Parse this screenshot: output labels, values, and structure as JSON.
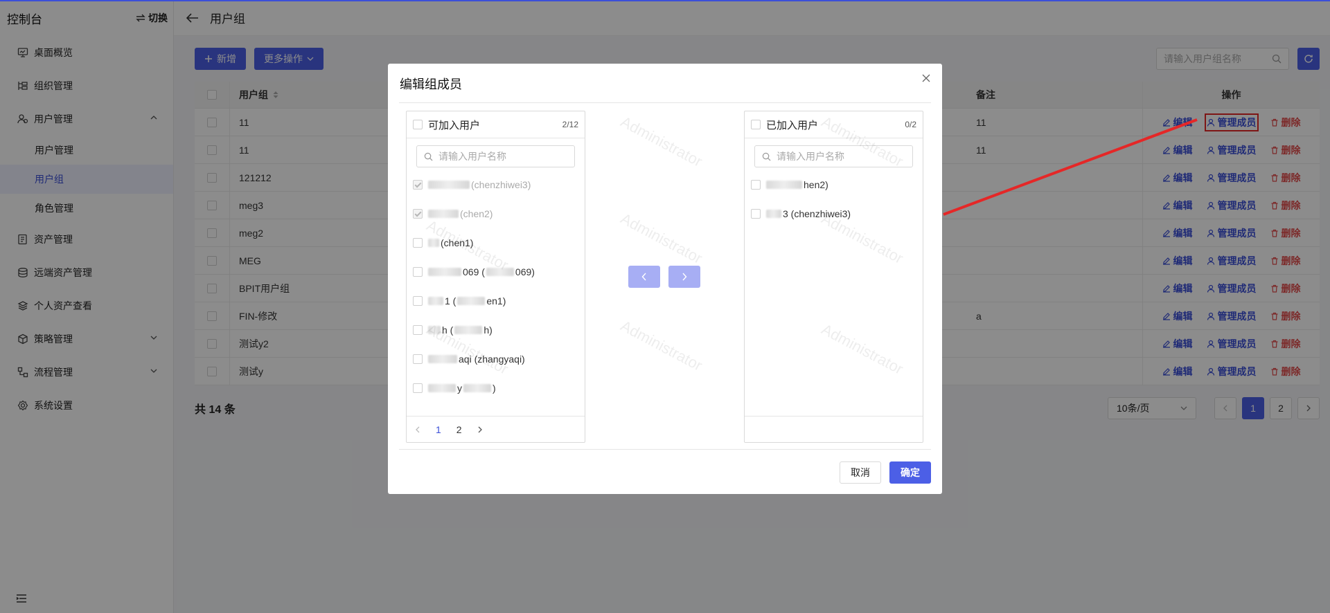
{
  "sidebar": {
    "title": "控制台",
    "switch_label": "切换",
    "items": [
      {
        "label": "桌面概览",
        "icon": "monitor-icon"
      },
      {
        "label": "组织管理",
        "icon": "org-tree-icon"
      },
      {
        "label": "用户管理",
        "icon": "users-icon"
      },
      {
        "label": "资产管理",
        "icon": "asset-icon"
      },
      {
        "label": "远端资产管理",
        "icon": "remote-asset-icon"
      },
      {
        "label": "个人资产查看",
        "icon": "layers-icon"
      },
      {
        "label": "策略管理",
        "icon": "cube-icon"
      },
      {
        "label": "流程管理",
        "icon": "flow-icon"
      },
      {
        "label": "系统设置",
        "icon": "gear-icon"
      }
    ],
    "sub_items": [
      "用户管理",
      "用户组",
      "角色管理"
    ]
  },
  "header": {
    "title": "用户组"
  },
  "toolbar": {
    "add_label": "新增",
    "more_label": "更多操作",
    "search_placeholder": "请输入用户组名称"
  },
  "table": {
    "columns": {
      "name": "用户组",
      "note": "备注",
      "ops": "操作"
    },
    "ops": {
      "edit": "编辑",
      "member": "管理成员",
      "delete": "删除"
    },
    "rows": [
      {
        "name": "11",
        "note": "11"
      },
      {
        "name": "11",
        "note": "11"
      },
      {
        "name": "121212",
        "note": ""
      },
      {
        "name": "meg3",
        "note": ""
      },
      {
        "name": "meg2",
        "note": ""
      },
      {
        "name": "MEG",
        "note": ""
      },
      {
        "name": "BPIT用户组",
        "note": ""
      },
      {
        "name": "FIN-修改",
        "note": "a"
      },
      {
        "name": "测试y2",
        "note": ""
      },
      {
        "name": "测试y",
        "note": ""
      }
    ],
    "total": "共 14 条",
    "page_size": "10条/页",
    "pages": [
      "1",
      "2"
    ]
  },
  "modal": {
    "title": "编辑组成员",
    "left": {
      "title": "可加入用户",
      "count": "2/12",
      "placeholder": "请输入用户名称",
      "items": [
        {
          "visible": "(chenzhiwei3)",
          "checked": true,
          "disabled": true
        },
        {
          "visible": "(chen2)",
          "checked": true,
          "disabled": true
        },
        {
          "visible": "(chen1)",
          "checked": false,
          "disabled": false
        },
        {
          "visible": "069 (",
          "tail": "069)",
          "checked": false,
          "disabled": false
        },
        {
          "visible": "1 (",
          "tail": "en1)",
          "checked": false,
          "disabled": false
        },
        {
          "visible": "h (",
          "tail": "h)",
          "checked": false,
          "disabled": false
        },
        {
          "visible": "aqi (zhangyaqi)",
          "checked": false,
          "disabled": false
        },
        {
          "visible": "y",
          "tail": ")",
          "checked": false,
          "disabled": false
        }
      ],
      "pages": [
        "1",
        "2"
      ]
    },
    "right": {
      "title": "已加入用户",
      "count": "0/2",
      "placeholder": "请输入用户名称",
      "items": [
        {
          "visible": "hen2)"
        },
        {
          "visible": "3 (chenzhiwei3)"
        }
      ]
    },
    "cancel_label": "取消",
    "ok_label": "确定",
    "watermark": "Administrator"
  },
  "colors": {
    "primary": "#4c5fe6",
    "danger": "#e24b4b",
    "highlight": "#e52727"
  }
}
